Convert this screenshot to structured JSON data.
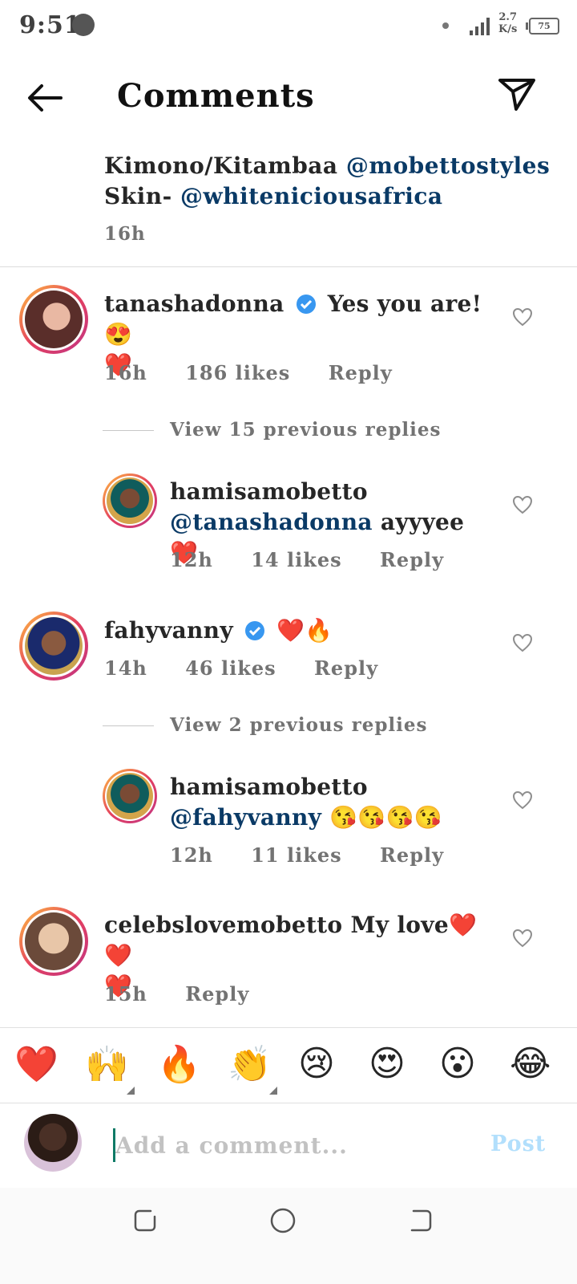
{
  "status_bar": {
    "time": "9:51",
    "net_speed_value": "2.7",
    "net_speed_unit": "K/s",
    "battery": "75"
  },
  "header": {
    "title": "Comments"
  },
  "caption": {
    "line1_text": "Kimono/Kitambaa ",
    "line1_mention": "@mobettostyles",
    "line2_text": "Skin- ",
    "line2_mention": "@whiteniciousafrica",
    "time": "16h"
  },
  "comments": [
    {
      "username": "tanashadonna",
      "text": "Yes you are! 😍",
      "text2": "❤️",
      "time": "16h",
      "likes": "186 likes",
      "reply": "Reply",
      "view_more": "View 15 previous replies",
      "reply_item": {
        "username": "hamisamobetto",
        "mention": "@tanashadonna",
        "text": " ayyyee❤️",
        "time": "12h",
        "likes": "14 likes",
        "reply": "Reply"
      }
    },
    {
      "username": "fahyvanny",
      "text": "❤️🔥",
      "time": "14h",
      "likes": "46 likes",
      "reply": "Reply",
      "view_more": "View 2 previous replies",
      "reply_item": {
        "username": "hamisamobetto",
        "mention": "@fahyvanny",
        "text": " 😘😘😘😘",
        "time": "12h",
        "likes": "11 likes",
        "reply": "Reply"
      }
    },
    {
      "username": "celebslovemobetto",
      "text": " My love❤️❤️",
      "text2": "❤️",
      "time": "15h",
      "reply": "Reply"
    }
  ],
  "quick_emojis": [
    "❤️",
    "🙌",
    "🔥",
    "👏",
    "😢",
    "😍",
    "😮",
    "😂"
  ],
  "composer": {
    "placeholder": "Add a comment...",
    "post_label": "Post"
  },
  "colors": {
    "link": "#0a3a66",
    "verified": "#3897f0",
    "post_disabled": "#b2dffc",
    "meta": "#737373"
  }
}
